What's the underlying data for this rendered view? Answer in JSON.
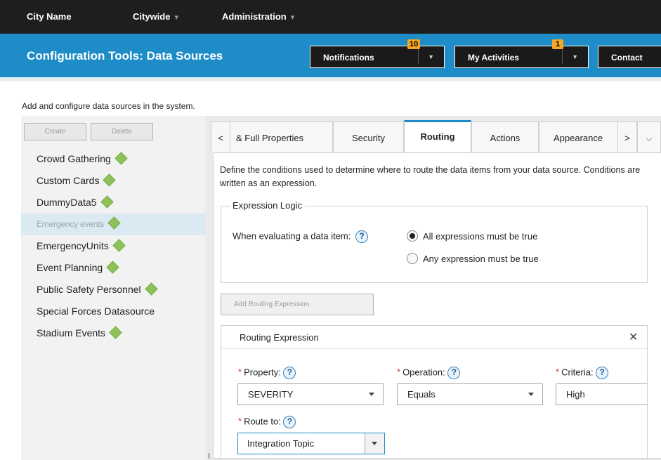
{
  "topnav": {
    "city": "City Name",
    "citywide": "Citywide",
    "administration": "Administration"
  },
  "header": {
    "title": "Configuration Tools: Data Sources",
    "notifications": {
      "label": "Notifications",
      "badge": "10"
    },
    "my_activities": {
      "label": "My Activities",
      "badge": "1"
    },
    "contact": {
      "label": "Contact"
    }
  },
  "page": {
    "description": "Add and configure data sources in the system."
  },
  "sidebar": {
    "create_label": "Create",
    "delete_label": "Delete",
    "items": [
      {
        "label": "Crowd Gathering",
        "status": true
      },
      {
        "label": "Custom Cards",
        "status": true
      },
      {
        "label": "DummyData5",
        "status": true
      },
      {
        "label": "Emergency events",
        "status": true,
        "selected": true
      },
      {
        "label": "EmergencyUnits",
        "status": true
      },
      {
        "label": "Event Planning",
        "status": true
      },
      {
        "label": "Public Safety Personnel",
        "status": true
      },
      {
        "label": "Special Forces Datasource",
        "status": false
      },
      {
        "label": "Stadium Events",
        "status": true
      }
    ]
  },
  "tabs": {
    "prev": "<",
    "next": ">",
    "more": "v",
    "items": [
      {
        "label": "& Full Properties"
      },
      {
        "label": "Security"
      },
      {
        "label": "Routing",
        "active": true
      },
      {
        "label": "Actions"
      },
      {
        "label": "Appearance"
      }
    ]
  },
  "routing": {
    "description": "Define the conditions used to determine where to route the data items from your data source. Conditions are written as an expression.",
    "logic_legend": "Expression Logic",
    "evaluate_label": "When evaluating a data item:",
    "option_all": "All expressions must be true",
    "option_any": "Any expression must be true",
    "add_button": "Add Routing Expression",
    "expression": {
      "title": "Routing Expression",
      "property_label": "Property:",
      "property_value": "SEVERITY",
      "operation_label": "Operation:",
      "operation_value": "Equals",
      "criteria_label": "Criteria:",
      "criteria_value": "High",
      "route_label": "Route to:",
      "route_value": "Integration Topic"
    }
  },
  "colors": {
    "header_blue": "#1d8cc7",
    "badge_orange": "#f5a623",
    "status_green": "#8dc25a",
    "required_red": "#d0312d"
  }
}
